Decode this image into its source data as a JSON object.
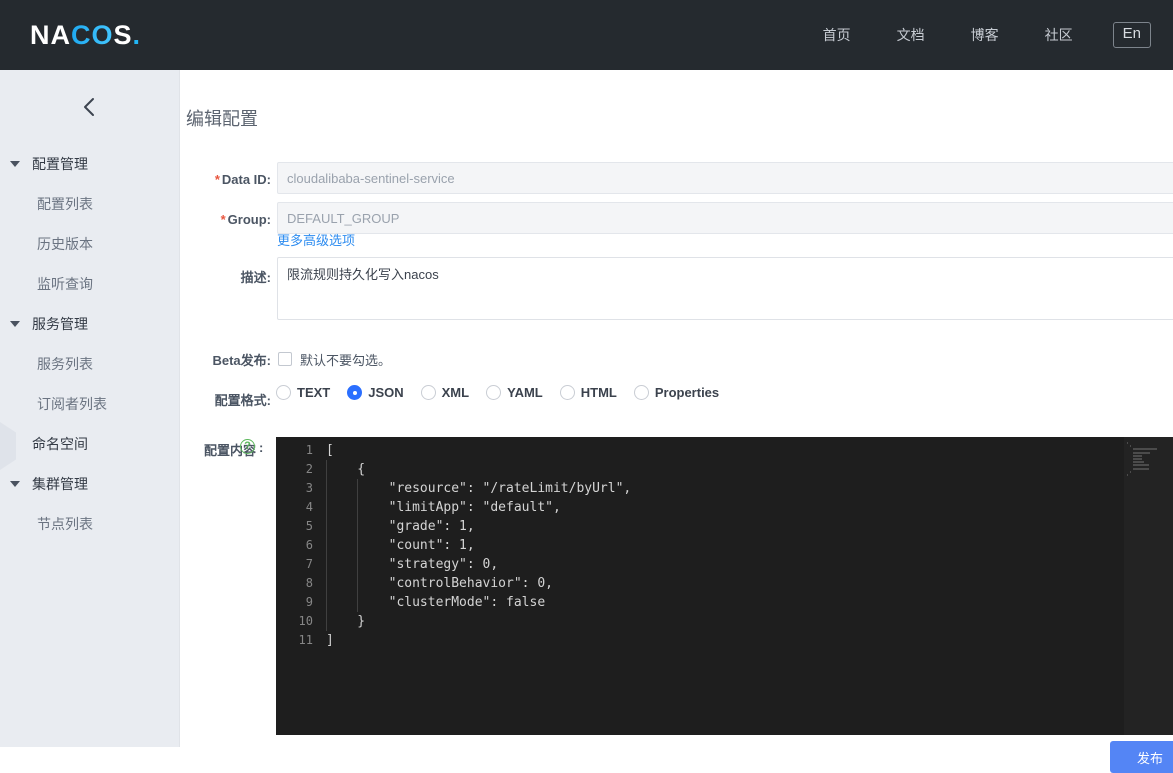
{
  "header": {
    "logo": {
      "part1": "NA",
      "part2": "CO",
      "part3": "S",
      "dot": "."
    },
    "nav": [
      {
        "label": "首页",
        "name": "nav-home"
      },
      {
        "label": "文档",
        "name": "nav-docs"
      },
      {
        "label": "博客",
        "name": "nav-blog"
      },
      {
        "label": "社区",
        "name": "nav-community"
      }
    ],
    "lang_toggle": "En"
  },
  "sidebar": {
    "collapse_icon": "chevron-left-icon",
    "groups": [
      {
        "label": "配置管理",
        "expanded": true,
        "items": [
          {
            "label": "配置列表"
          },
          {
            "label": "历史版本"
          },
          {
            "label": "监听查询"
          }
        ]
      },
      {
        "label": "服务管理",
        "expanded": true,
        "items": [
          {
            "label": "服务列表"
          },
          {
            "label": "订阅者列表"
          }
        ]
      },
      {
        "label": "命名空间",
        "expanded": false,
        "items": []
      },
      {
        "label": "集群管理",
        "expanded": true,
        "items": [
          {
            "label": "节点列表"
          }
        ]
      }
    ]
  },
  "main": {
    "page_title": "编辑配置",
    "form": {
      "data_id": {
        "label": "Data ID:",
        "required": true,
        "value": "cloudalibaba-sentinel-service",
        "disabled": true
      },
      "group": {
        "label": "Group:",
        "required": true,
        "value": "DEFAULT_GROUP",
        "disabled": true
      },
      "advanced_link": "更多高级选项",
      "description": {
        "label": "描述:",
        "value": "限流规则持久化写入nacos"
      },
      "beta": {
        "label": "Beta发布:",
        "checked": false,
        "hint": "默认不要勾选。"
      },
      "format": {
        "label": "配置格式:",
        "selected": "JSON",
        "options": [
          "TEXT",
          "JSON",
          "XML",
          "YAML",
          "HTML",
          "Properties"
        ]
      },
      "content": {
        "label": "配置内容",
        "help_icon": "question-mark-icon",
        "colon": ":",
        "lines": [
          "[",
          "    {",
          "        \"resource\": \"/rateLimit/byUrl\",",
          "        \"limitApp\": \"default\",",
          "        \"grade\": 1,",
          "        \"count\": 1,",
          "        \"strategy\": 0,",
          "        \"controlBehavior\": 0,",
          "        \"clusterMode\": false",
          "    }",
          "]"
        ]
      }
    },
    "submit_label": "发布"
  },
  "colors": {
    "header_bg": "#252a2f",
    "sidebar_bg": "#e9ecf1",
    "accent_blue": "#2b6fff",
    "button_blue": "#5485f5",
    "editor_bg": "#1e1e1e",
    "link_blue": "#2d8cf0",
    "required_red": "#e8563f",
    "help_green": "#5cb85c",
    "logo_blue": "#22b6f5"
  }
}
